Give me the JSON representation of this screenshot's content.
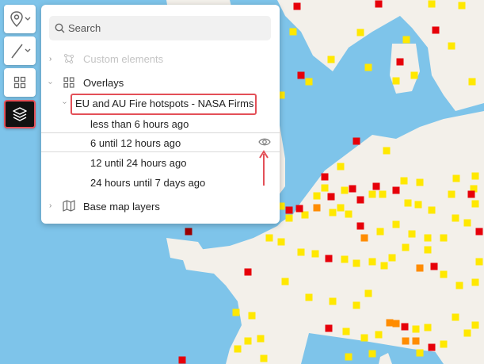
{
  "toolbar": {
    "buttons": [
      {
        "icon": "map-pin-icon",
        "has_dropdown": true
      },
      {
        "icon": "line-draw-icon",
        "has_dropdown": true
      },
      {
        "icon": "grid-icon",
        "has_dropdown": false
      },
      {
        "icon": "layers-icon",
        "has_dropdown": false,
        "active": true
      }
    ]
  },
  "panel": {
    "search": {
      "placeholder": "Search"
    },
    "tree": {
      "custom_elements": "Custom elements",
      "overlays": "Overlays",
      "overlay_group": "EU and AU Fire hotspots - NASA Firms",
      "overlay_items": [
        "less than 6 hours ago",
        "6 until 12 hours ago",
        "12 until 24 hours ago",
        "24 hours until 7 days ago"
      ],
      "base_map_layers": "Base map layers"
    }
  },
  "colors": {
    "sea": "#7ec4ea",
    "land": "#f3f0ea",
    "hotspot_red": "#e6000a",
    "hotspot_darkred": "#9b0000",
    "hotspot_orange": "#ff8c00",
    "hotspot_yellow": "#ffe800",
    "highlight": "#e35058"
  }
}
